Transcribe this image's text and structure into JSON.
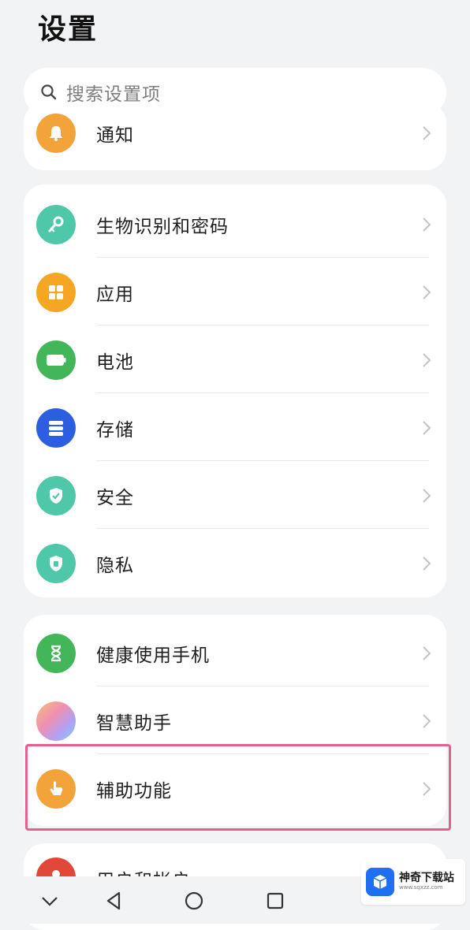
{
  "header": {
    "title": "设置"
  },
  "search": {
    "placeholder": "搜索设置项"
  },
  "card_top": {
    "items": [
      {
        "label": "通知",
        "icon": "bell-icon",
        "color": "#f2a33a"
      }
    ]
  },
  "card_main": {
    "items": [
      {
        "label": "生物识别和密码",
        "icon": "key-icon",
        "color": "#4fc7a9"
      },
      {
        "label": "应用",
        "icon": "apps-grid-icon",
        "color": "#f5a623"
      },
      {
        "label": "电池",
        "icon": "battery-icon",
        "color": "#43b65a"
      },
      {
        "label": "存储",
        "icon": "storage-icon",
        "color": "#2c5fe0"
      },
      {
        "label": "安全",
        "icon": "shield-icon",
        "color": "#4fc7a9"
      },
      {
        "label": "隐私",
        "icon": "privacy-shield-icon",
        "color": "#4fc7a9"
      }
    ]
  },
  "card_lower": {
    "items": [
      {
        "label": "健康使用手机",
        "icon": "hourglass-icon",
        "color": "#43b65a"
      },
      {
        "label": "智慧助手",
        "icon": "smart-assistant-icon",
        "color": "#c6a0f0"
      },
      {
        "label": "辅助功能",
        "icon": "hand-pointer-icon",
        "color": "#f2a33a"
      }
    ]
  },
  "card_bottom": {
    "items": [
      {
        "label": "用户和帐户",
        "icon": "user-icon",
        "color": "#e2483a"
      }
    ]
  },
  "navbar": {
    "buttons": [
      "collapse-icon",
      "back-icon",
      "home-icon",
      "recents-icon"
    ]
  },
  "watermark": {
    "brand": "神奇下载站",
    "url": "www.sqxzz.com"
  }
}
